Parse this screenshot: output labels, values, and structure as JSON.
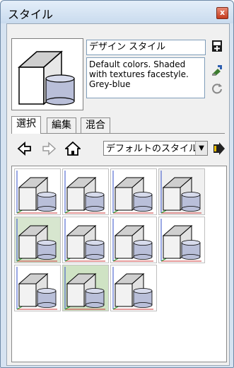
{
  "window": {
    "title": "スタイル",
    "close_label": "x"
  },
  "style": {
    "name": "デザイン スタイル",
    "description": "Default colors.  Shaded with textures facestyle.  Grey-blue"
  },
  "tabs": [
    {
      "label": "選択",
      "active": true
    },
    {
      "label": "編集",
      "active": false
    },
    {
      "label": "混合",
      "active": false
    }
  ],
  "collection": {
    "selected": "デフォルトのスタイル"
  },
  "thumbnails": [
    {
      "label": "style-1",
      "bg": "#ffffff"
    },
    {
      "label": "style-2",
      "bg": "#ffffff"
    },
    {
      "label": "style-3",
      "bg": "#ffffff"
    },
    {
      "label": "style-4",
      "bg": "#f0f0f0"
    },
    {
      "label": "style-5",
      "bg": "#d7e6cf"
    },
    {
      "label": "style-6",
      "bg": "#ffffff"
    },
    {
      "label": "style-7",
      "bg": "#ffffff"
    },
    {
      "label": "style-8",
      "bg": "#ffffff"
    },
    {
      "label": "style-9",
      "bg": "#ffffff"
    },
    {
      "label": "style-10",
      "bg": "#cfe3c4"
    },
    {
      "label": "style-11",
      "bg": "#ffffff"
    }
  ]
}
